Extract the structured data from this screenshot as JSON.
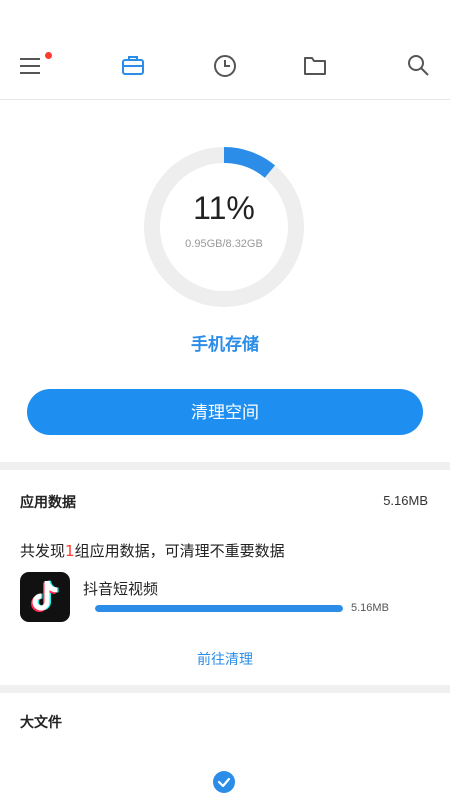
{
  "storage": {
    "percent_text": "11%",
    "used_fraction": 0.11,
    "usage_text": "0.95GB/8.32GB",
    "label": "手机存储"
  },
  "actions": {
    "clean_button": "清理空间"
  },
  "app_data": {
    "title": "应用数据",
    "size": "5.16MB",
    "found_prefix": "共发现",
    "found_count": "1",
    "found_suffix": "组应用数据，可清理不重要数据",
    "items": [
      {
        "name": "抖音短视频",
        "size": "5.16MB",
        "fill_fraction": 1.0
      }
    ],
    "link": "前往清理"
  },
  "big_files": {
    "title": "大文件"
  },
  "colors": {
    "accent": "#2b8de8",
    "button": "#1e8ff0",
    "badge": "#ff3b30",
    "ring_track": "#eeeeee"
  },
  "icons": {
    "topbar": [
      "menu-icon",
      "toolbox-icon",
      "clock-icon",
      "folder-icon",
      "search-icon"
    ],
    "app": "tiktok-logo-icon",
    "bottom": "check-icon"
  }
}
